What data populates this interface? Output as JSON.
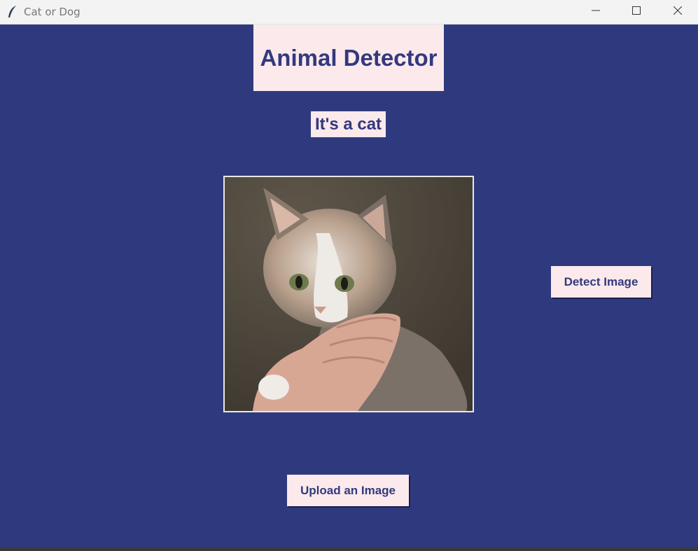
{
  "window": {
    "title": "Cat or Dog",
    "icon": "feather-icon",
    "controls": [
      "minimize-icon",
      "maximize-icon",
      "close-icon"
    ]
  },
  "app": {
    "heading": "Animal Detector",
    "result": "It's a cat",
    "image": {
      "subject": "kitten-photo"
    },
    "buttons": {
      "detect": "Detect Image",
      "upload": "Upload an Image"
    }
  },
  "colors": {
    "background": "#2f3a7e",
    "label_bg": "#fbe9ec",
    "text": "#33397d"
  }
}
